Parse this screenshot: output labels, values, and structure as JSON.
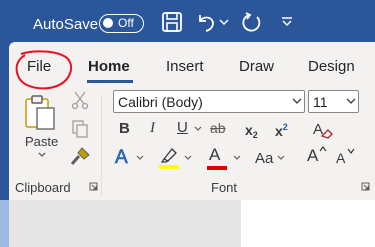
{
  "titlebar": {
    "autosave_label": "AutoSave",
    "autosave_state": "Off",
    "icons": [
      "save-icon",
      "undo-icon",
      "redo-icon",
      "customize-quick-access-icon"
    ]
  },
  "tabs": [
    {
      "label": "File"
    },
    {
      "label": "Home",
      "selected": true
    },
    {
      "label": "Insert"
    },
    {
      "label": "Draw"
    },
    {
      "label": "Design"
    }
  ],
  "clipboard": {
    "paste_label": "Paste",
    "group_label": "Clipboard"
  },
  "font": {
    "font_name": "Calibri (Body)",
    "font_size": "11",
    "group_label": "Font",
    "bold": "B",
    "italic": "I",
    "underline": "U",
    "strikethrough": "ab",
    "subscript": "x",
    "subscript_mark": "2",
    "superscript": "x",
    "superscript_mark": "2",
    "change_case": "Aa",
    "grow": "A",
    "shrink": "A",
    "text_effects": "A",
    "font_color": "A"
  },
  "colors": {
    "brand": "#2b579a",
    "highlight": "#ffff00",
    "font_color": "#e00000",
    "annotation": "#e81123"
  }
}
